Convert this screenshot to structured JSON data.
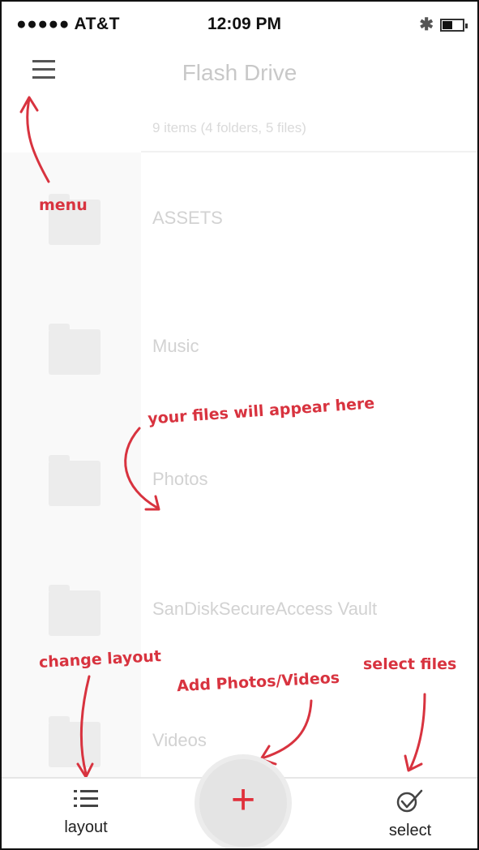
{
  "status_bar": {
    "carrier": "●●●●● AT&T",
    "time": "12:09 PM"
  },
  "header": {
    "title": "Flash Drive",
    "menu_icon": "hamburger-icon"
  },
  "summary": "9 items (4 folders, 5 files)",
  "files": [
    {
      "name": "ASSETS",
      "icon": "folder-icon"
    },
    {
      "name": "Music",
      "icon": "folder-icon"
    },
    {
      "name": "Photos",
      "icon": "folder-icon"
    },
    {
      "name": "SanDiskSecureAccess Vault",
      "icon": "folder-icon"
    },
    {
      "name": "Videos",
      "icon": "folder-icon"
    }
  ],
  "annotations": {
    "menu": "menu",
    "files": "your files will appear here",
    "layout": "change layout",
    "add": "Add Photos/Videos",
    "select": "select files"
  },
  "bottom_bar": {
    "layout_label": "layout",
    "add_symbol": "+",
    "select_label": "select"
  },
  "colors": {
    "accent": "#d8333f",
    "faded_text": "#d2d2d2"
  }
}
